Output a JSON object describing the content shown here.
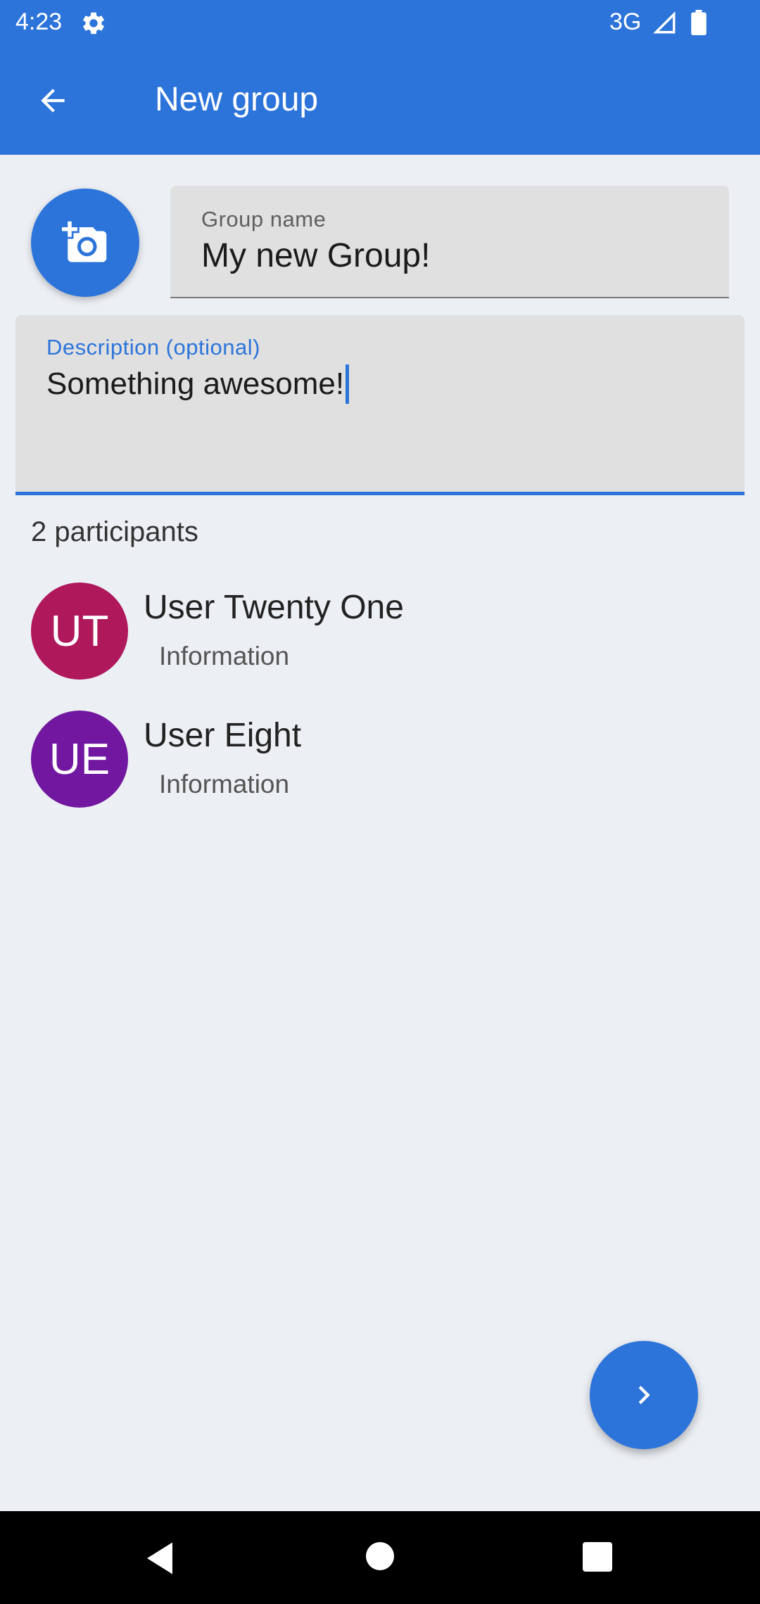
{
  "status_bar": {
    "time": "4:23",
    "network": "3G",
    "icons": [
      "gear-icon",
      "signal-icon",
      "battery-icon"
    ]
  },
  "app_bar": {
    "title": "New group",
    "back_icon": "arrow-back-icon"
  },
  "photo_button": {
    "icon": "add-photo-icon"
  },
  "group_name": {
    "label": "Group name",
    "value": "My new Group!"
  },
  "description": {
    "label": "Description (optional)",
    "value": "Something awesome!"
  },
  "participants": {
    "count_label": "2 participants",
    "items": [
      {
        "initials": "UT",
        "name": "User Twenty One",
        "info": "Information",
        "color": "#B0185C"
      },
      {
        "initials": "UE",
        "name": "User Eight",
        "info": "Information",
        "color": "#7218A0"
      }
    ]
  },
  "fab": {
    "icon": "chevron-right-icon"
  },
  "colors": {
    "primary": "#2C74DA",
    "background": "#ECEFF4"
  },
  "nav_bar": {
    "icons": [
      "nav-back-icon",
      "nav-home-icon",
      "nav-recents-icon"
    ]
  }
}
